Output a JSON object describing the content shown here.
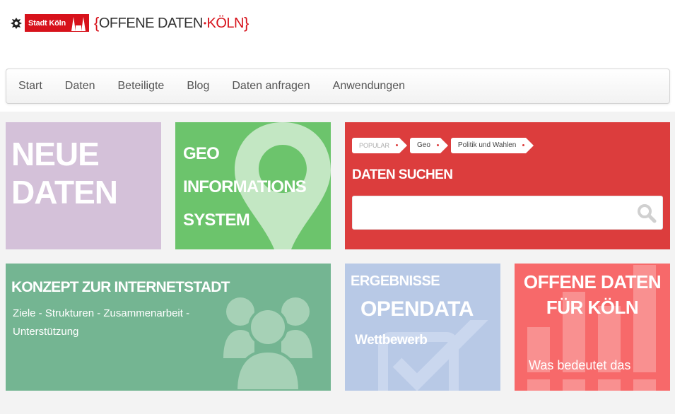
{
  "header": {
    "city_label": "Stadt Köln",
    "brand_left": "OFFENE DATEN",
    "brand_right": "KÖLN",
    "brand_open_brace": "{",
    "brand_close_brace": "}",
    "brand_dot": "•"
  },
  "nav": {
    "items": [
      {
        "label": "Start"
      },
      {
        "label": "Daten"
      },
      {
        "label": "Beteiligte"
      },
      {
        "label": "Blog"
      },
      {
        "label": "Daten anfragen"
      },
      {
        "label": "Anwendungen"
      }
    ]
  },
  "tiles": {
    "neue_daten": {
      "line1": "NEUE",
      "line2": "DATEN",
      "color": "#d4c1d9"
    },
    "geo": {
      "line1": "GEO",
      "line2": "INFORMATIONS",
      "line3": "SYSTEM",
      "color": "#6cc46c"
    },
    "search": {
      "color": "#dc3d3d",
      "tags": [
        {
          "label": "POPULAR"
        },
        {
          "label": "Geo"
        },
        {
          "label": "Politik und Wahlen"
        }
      ],
      "title": "DATEN SUCHEN",
      "input_value": ""
    },
    "konzept": {
      "title": "KONZEPT ZUR INTERNETSTADT",
      "subtitle": "Ziele - Strukturen - Zusammenarbeit - Unterstützung",
      "color": "#74b592"
    },
    "ergebnisse": {
      "line1": "ERGEBNISSE",
      "line2": "OPENDATA",
      "line3": "Wettbewerb",
      "color": "#b8c9e6"
    },
    "offene": {
      "line1": "OFFENE DATEN",
      "line2": "FÜR KÖLN",
      "subtitle": "Was bedeutet das",
      "color": "#f7696a"
    }
  }
}
